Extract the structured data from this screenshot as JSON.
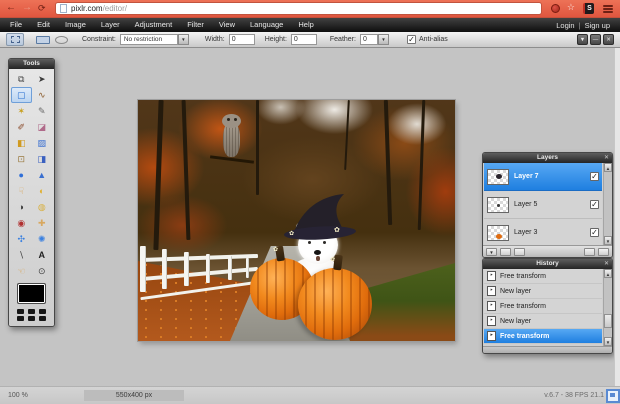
{
  "ui": {
    "close": "✕",
    "check": "✓",
    "arrow_up": "▲",
    "arrow_down": "▼",
    "dropdown": "▼",
    "minimize": "—",
    "back": "←",
    "forward": "→",
    "reload": "⟳",
    "star": "☆",
    "hist_icon": "‣"
  },
  "browser": {
    "url_host": "pixlr.com",
    "url_path": "/editor/",
    "extension_label": "S"
  },
  "menu_bar": {
    "items": [
      "File",
      "Edit",
      "Image",
      "Layer",
      "Adjustment",
      "Filter",
      "View",
      "Language",
      "Help"
    ],
    "login_label": "Login",
    "divider": "|",
    "signup_label": "Sign up"
  },
  "options_bar": {
    "constraint_label": "Constraint:",
    "constraint_value": "No restriction",
    "width_label": "Width:",
    "width_value": "0",
    "height_label": "Height:",
    "height_value": "0",
    "feather_label": "Feather:",
    "feather_value": "0",
    "antialias_label": "Anti-alias",
    "antialias_checked": true
  },
  "tools_panel": {
    "title": "Tools",
    "swatch_color": "#000000",
    "selected_tool": "marquee",
    "tools": [
      {
        "name": "crop",
        "glyph": "⧉",
        "color": "#4a4a4a"
      },
      {
        "name": "move",
        "glyph": "➤",
        "color": "#3a3a3a"
      },
      {
        "name": "marquee",
        "glyph": "▢",
        "color": "#2a6fd0",
        "selected": true
      },
      {
        "name": "lasso",
        "glyph": "∿",
        "color": "#8a5a2a"
      },
      {
        "name": "wand",
        "glyph": "✶",
        "color": "#c8a020"
      },
      {
        "name": "pencil",
        "glyph": "✎",
        "color": "#6a6a6a"
      },
      {
        "name": "brush",
        "glyph": "✐",
        "color": "#8a4a2a"
      },
      {
        "name": "eraser",
        "glyph": "◪",
        "color": "#b06a8a"
      },
      {
        "name": "paint-bucket",
        "glyph": "◧",
        "color": "#d09a20"
      },
      {
        "name": "gradient",
        "glyph": "▨",
        "color": "#3a6fd0"
      },
      {
        "name": "clone-stamp",
        "glyph": "⊡",
        "color": "#9a7a40"
      },
      {
        "name": "color-replace",
        "glyph": "◨",
        "color": "#3a60c0"
      },
      {
        "name": "blur",
        "glyph": "●",
        "color": "#2f6fd8"
      },
      {
        "name": "sharpen",
        "glyph": "▲",
        "color": "#3a70d0"
      },
      {
        "name": "smudge",
        "glyph": "☟",
        "color": "#d8a860"
      },
      {
        "name": "dodge",
        "glyph": "◐",
        "color": "#e0b030"
      },
      {
        "name": "burn",
        "glyph": "◑",
        "color": "#3a3a3a"
      },
      {
        "name": "sponge",
        "glyph": "◍",
        "color": "#d8b040"
      },
      {
        "name": "red-eye",
        "glyph": "◉",
        "color": "#b03030"
      },
      {
        "name": "spot-heal",
        "glyph": "✚",
        "color": "#d8a860"
      },
      {
        "name": "bloat",
        "glyph": "✣",
        "color": "#3a80e0"
      },
      {
        "name": "pinch",
        "glyph": "✺",
        "color": "#3a80e0"
      },
      {
        "name": "colorpicker",
        "glyph": "∖",
        "color": "#444444"
      },
      {
        "name": "type",
        "glyph": "A",
        "color": "#222222"
      },
      {
        "name": "hand",
        "glyph": "☜",
        "color": "#d8a860"
      },
      {
        "name": "zoom",
        "glyph": "⊙",
        "color": "#444444"
      }
    ]
  },
  "layers_panel": {
    "title": "Layers",
    "layers": [
      {
        "name": "Layer 7",
        "visible": true,
        "selected": true
      },
      {
        "name": "Layer 5",
        "visible": true,
        "selected": false
      },
      {
        "name": "Layer 3",
        "visible": true,
        "selected": false
      }
    ]
  },
  "history_panel": {
    "title": "History",
    "items": [
      {
        "label": "Free transform",
        "selected": false
      },
      {
        "label": "New layer",
        "selected": false
      },
      {
        "label": "Free transform",
        "selected": false
      },
      {
        "label": "New layer",
        "selected": false
      },
      {
        "label": "Free transform",
        "selected": true
      }
    ]
  },
  "status_bar": {
    "zoom": "100 %",
    "size": "550x400 px",
    "info": "v.6.7 - 38 FPS 21.1"
  },
  "accent_colors": {
    "selection_blue": "#1f7fe0",
    "browser_orange": "#e8644a"
  }
}
